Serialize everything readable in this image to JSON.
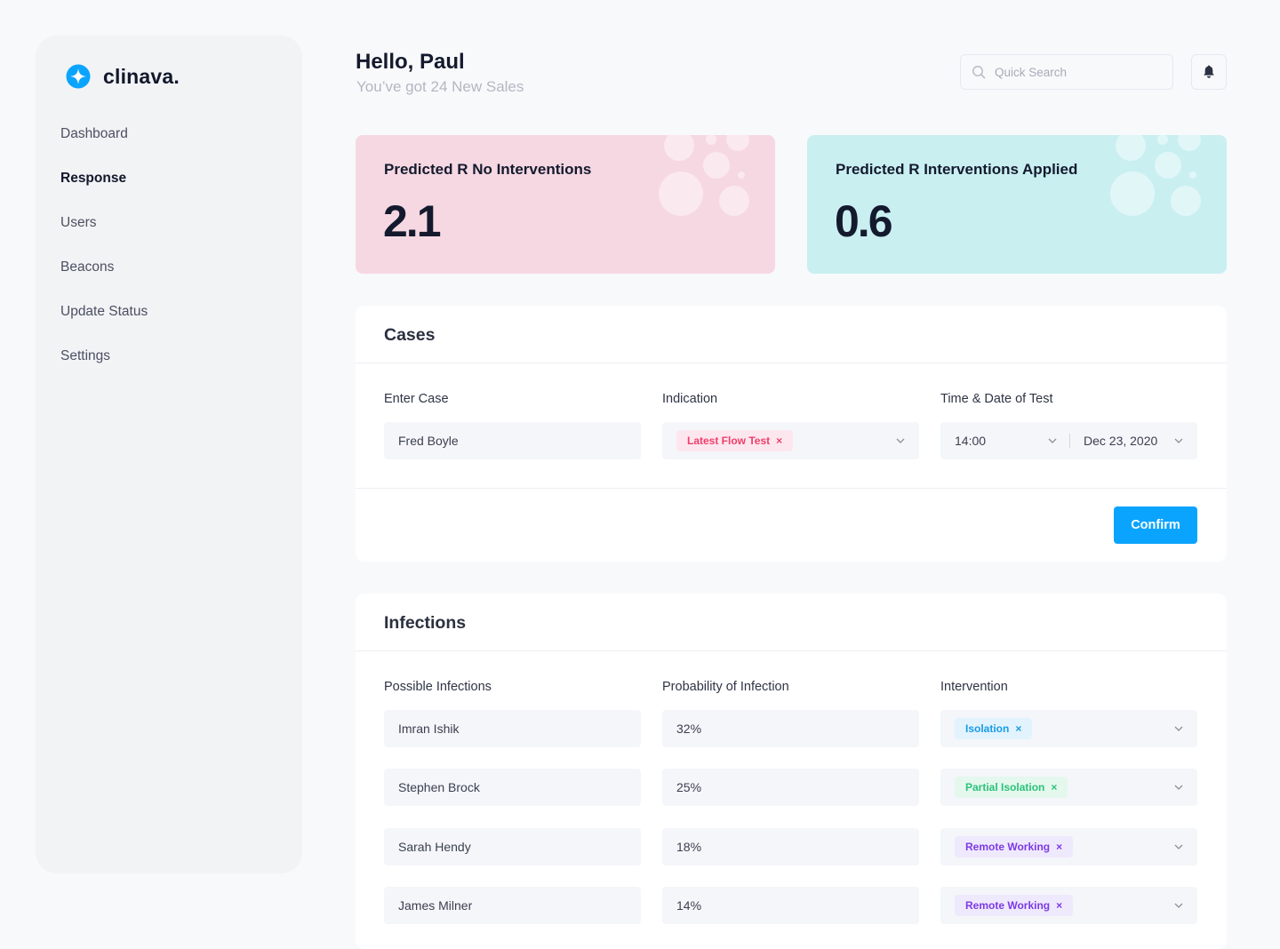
{
  "brand": {
    "name": "clinava."
  },
  "nav": {
    "items": [
      {
        "label": "Dashboard"
      },
      {
        "label": "Response",
        "active": true
      },
      {
        "label": "Users"
      },
      {
        "label": "Beacons"
      },
      {
        "label": "Update Status"
      },
      {
        "label": "Settings"
      }
    ]
  },
  "header": {
    "greeting": "Hello, Paul",
    "subtitle": "You’ve got 24 New Sales",
    "search_placeholder": "Quick Search",
    "icons": [
      "search-icon",
      "bell-icon"
    ]
  },
  "stats": [
    {
      "label": "Predicted R No Interventions",
      "value": "2.1",
      "color": "#f6d8e2"
    },
    {
      "label": "Predicted R Interventions Applied",
      "value": "0.6",
      "color": "#c9eff1"
    }
  ],
  "cases": {
    "title": "Cases",
    "enter_case_label": "Enter Case",
    "enter_case_value": "Fred Boyle",
    "indication_label": "Indication",
    "indication_tag": "Latest Flow Test",
    "time_date_label": "Time & Date of Test",
    "time_value": "14:00",
    "date_value": "Dec 23, 2020",
    "confirm_label": "Confirm"
  },
  "infections": {
    "title": "Infections",
    "col_possible": "Possible Infections",
    "col_probability": "Probability of Infection",
    "col_intervention": "Intervention",
    "rows": [
      {
        "name": "Imran Ishik",
        "probability": "32%",
        "intervention": "Isolation",
        "tag_color": "blue"
      },
      {
        "name": "Stephen Brock",
        "probability": "25%",
        "intervention": "Partial Isolation",
        "tag_color": "green"
      },
      {
        "name": "Sarah Hendy",
        "probability": "18%",
        "intervention": "Remote Working",
        "tag_color": "purple"
      },
      {
        "name": "James Milner",
        "probability": "14%",
        "intervention": "Remote Working",
        "tag_color": "purple"
      }
    ]
  },
  "colors": {
    "accent": "#0aa4ff",
    "pink_card": "#f6d8e2",
    "teal_card": "#c9eff1",
    "tag_pink": "#ef3e6a",
    "tag_blue": "#1a9be6",
    "tag_green": "#2cc27a",
    "tag_purple": "#7c3ae6"
  }
}
